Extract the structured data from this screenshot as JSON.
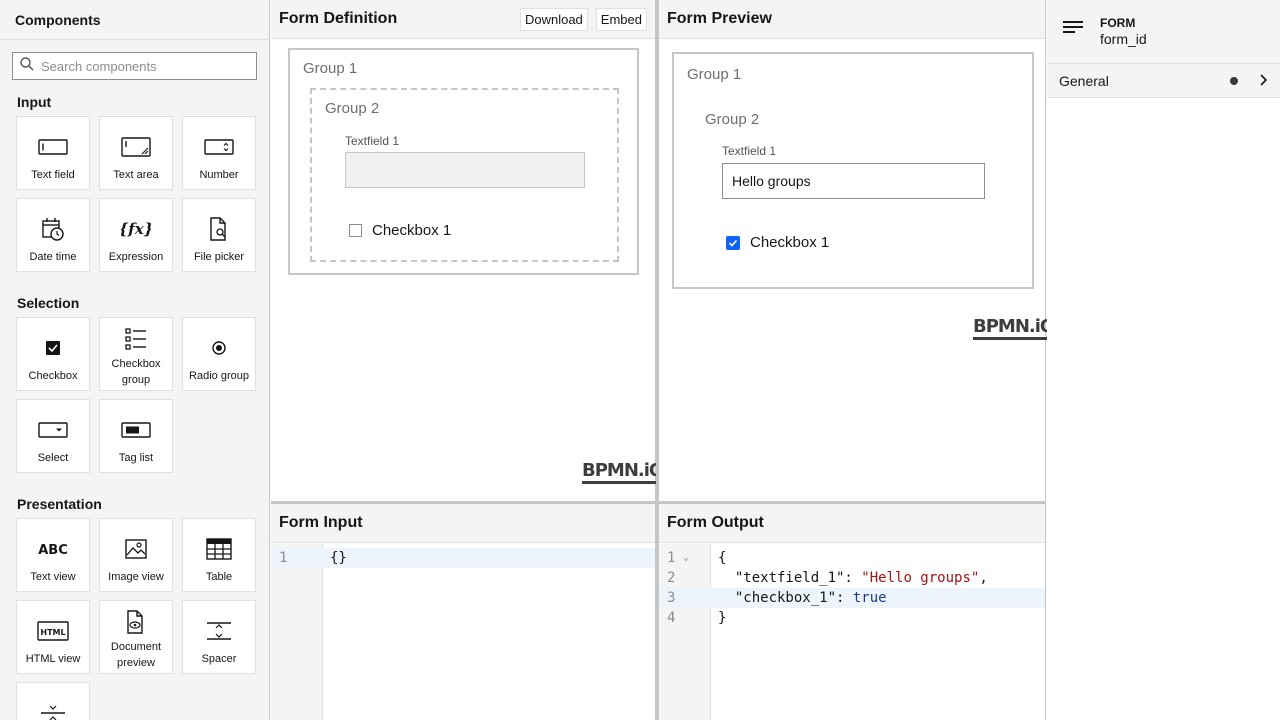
{
  "palette": {
    "title": "Components",
    "search_placeholder": "Search components",
    "groups": [
      {
        "title": "Input",
        "items": [
          "Text field",
          "Text area",
          "Number",
          "Date time",
          "Expression",
          "File picker"
        ]
      },
      {
        "title": "Selection",
        "items": [
          "Checkbox",
          "Checkbox group",
          "Radio group",
          "Select",
          "Tag list"
        ]
      },
      {
        "title": "Presentation",
        "items": [
          "Text view",
          "Image view",
          "Table",
          "HTML view",
          "Document preview",
          "Spacer"
        ]
      }
    ]
  },
  "definition": {
    "title": "Form Definition",
    "download_label": "Download",
    "embed_label": "Embed",
    "group1_label": "Group 1",
    "group2_label": "Group 2",
    "textfield_label": "Textfield 1",
    "checkbox_label": "Checkbox 1",
    "brand": "BPMN.iO"
  },
  "preview": {
    "title": "Form Preview",
    "group1_label": "Group 1",
    "group2_label": "Group 2",
    "textfield_label": "Textfield 1",
    "textfield_value": "Hello groups",
    "checkbox_label": "Checkbox 1",
    "checkbox_checked": true,
    "brand": "BPMN.iO"
  },
  "input": {
    "title": "Form Input",
    "lines": [
      "{}"
    ],
    "line_numbers": [
      "1"
    ]
  },
  "output": {
    "title": "Form Output",
    "line_numbers": [
      "1",
      "2",
      "3",
      "4"
    ],
    "line1": "{",
    "line2_key": "  \"textfield_1\": ",
    "line2_val": "\"Hello groups\"",
    "line2_end": ",",
    "line3_key": "  \"checkbox_1\": ",
    "line3_val": "true",
    "line4": "}"
  },
  "properties": {
    "type_label": "FORM",
    "id_value": "form_id",
    "group_label": "General"
  }
}
